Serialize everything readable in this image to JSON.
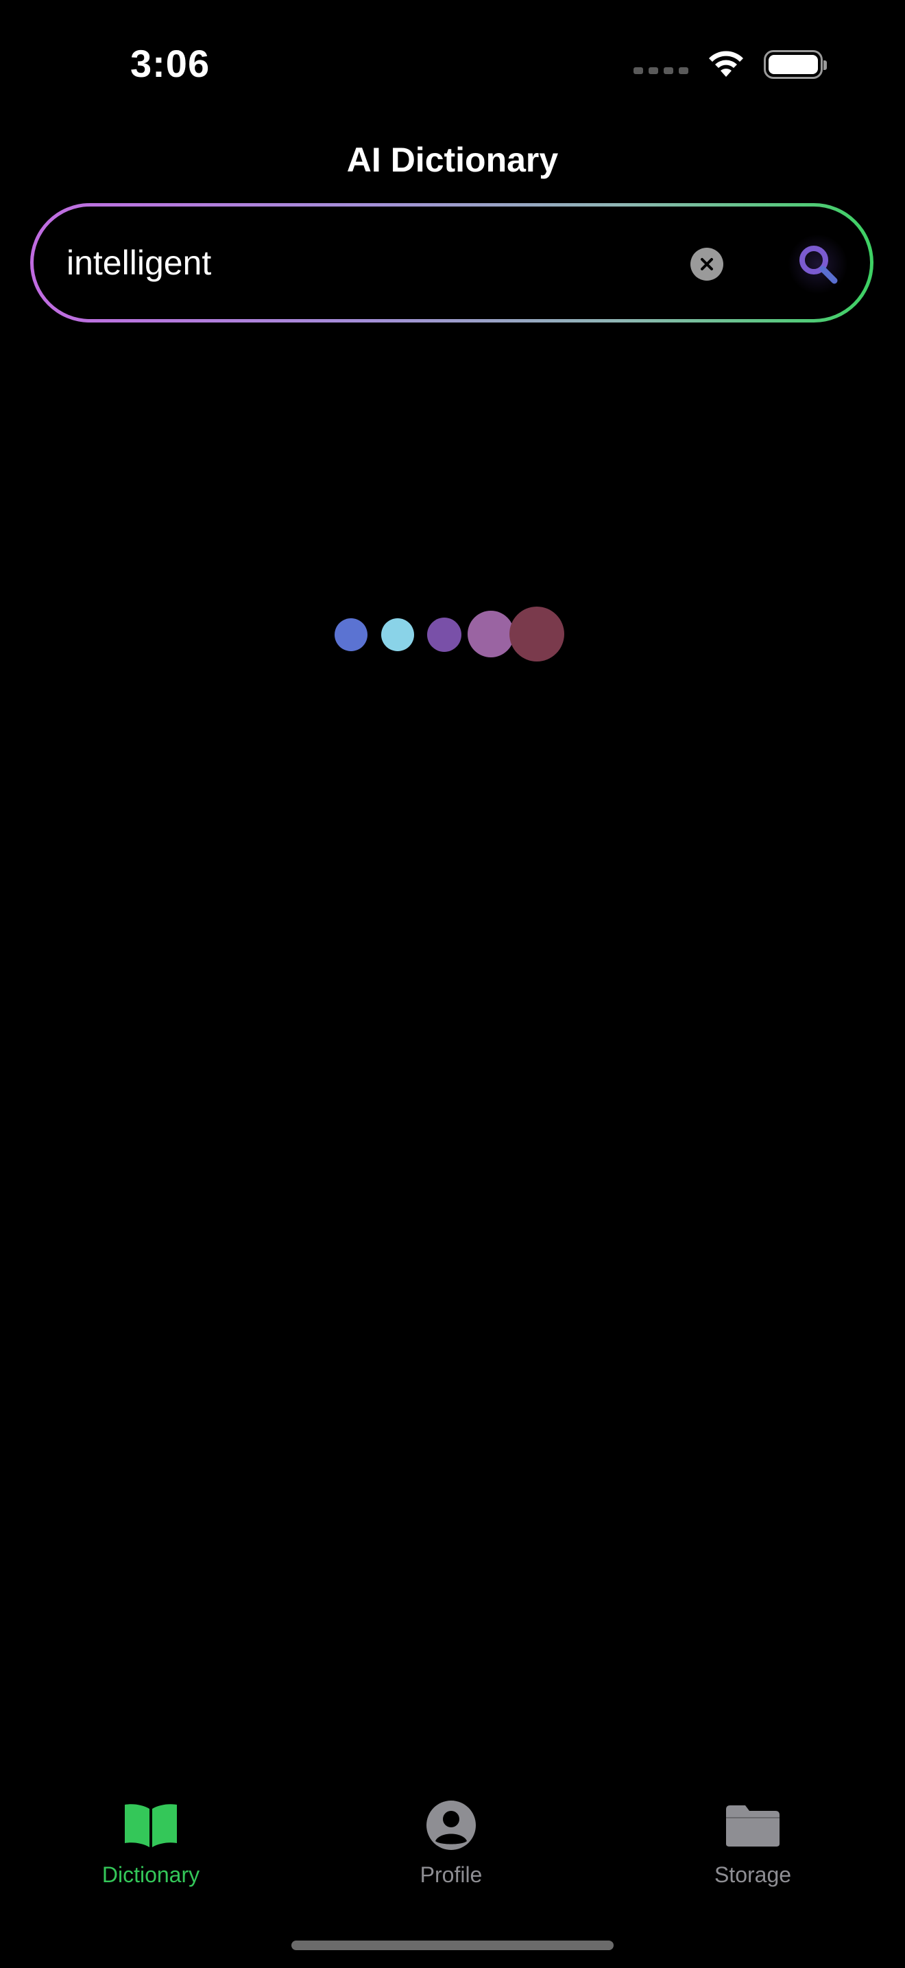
{
  "status_bar": {
    "time": "3:06"
  },
  "header": {
    "title": "AI Dictionary"
  },
  "search": {
    "value": "intelligent",
    "clear_icon": "clear-x-icon",
    "search_icon": "magnifying-glass-icon"
  },
  "loader": {
    "dot_colors": [
      "#5b73d2",
      "#8ad3e8",
      "#7950a8",
      "#9a64a2",
      "#7a3a4c"
    ]
  },
  "tabs": [
    {
      "label": "Dictionary",
      "icon": "book-icon",
      "active": true
    },
    {
      "label": "Profile",
      "icon": "person-icon",
      "active": false
    },
    {
      "label": "Storage",
      "icon": "folder-icon",
      "active": false
    }
  ],
  "colors": {
    "accent_green": "#34c759",
    "search_purple": "#7b5bd0",
    "inactive_gray": "#8e8e93"
  }
}
